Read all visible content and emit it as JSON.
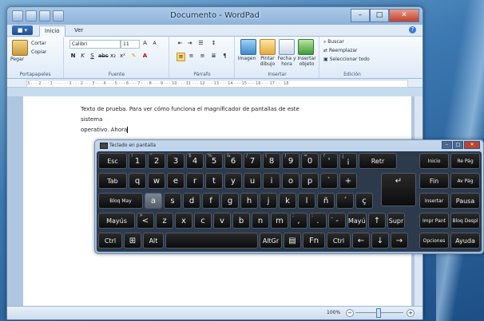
{
  "window": {
    "title": "Documento - WordPad",
    "buttons": {
      "minimize": "–",
      "maximize": "□",
      "close": "✕"
    }
  },
  "ribbon": {
    "file_tab": "■ ▾",
    "tabs": [
      "Inicio",
      "Ver"
    ],
    "clipboard": {
      "paste": "Pegar",
      "cut": "Cortar",
      "copy": "Copiar",
      "label": "Portapapeles"
    },
    "font": {
      "family": "Calibri",
      "size": "11",
      "label": "Fuente"
    },
    "paragraph": {
      "label": "Párrafo"
    },
    "insert": {
      "image": "Imagen",
      "paint": "Pintar dibujo",
      "datetime": "Fecha y hora",
      "object": "Insertar objeto",
      "label": "Insertar"
    },
    "edit": {
      "find": "Buscar",
      "replace": "Reemplazar",
      "select_all": "Seleccionar todo",
      "label": "Edición"
    }
  },
  "ruler": "3 · · · 2 · · · 1 · · · · · · 1 · · · 2 · · · 3 · · · 4 · · · 5 · · · 6 · · · 7 · · · 8 · · · 9 · · · 10 · · · 11 · · · 12 · · · 13 · · · 14 · · · 15 · · · 16 · · · 17 · · · 18",
  "document": {
    "line1": "Texto de prueba. Para ver cómo funciona el magnificador de pantallas de este sistema",
    "line2": "operativo. Ahora"
  },
  "status": {
    "zoom": "100%"
  },
  "osk": {
    "title": "Teclado en pantalla",
    "row1": [
      {
        "id": "esc",
        "label": "Esc"
      },
      {
        "id": "1",
        "label": "1",
        "sub": "!"
      },
      {
        "id": "2",
        "label": "2",
        "sub": "\""
      },
      {
        "id": "3",
        "label": "3",
        "sub": "·"
      },
      {
        "id": "4",
        "label": "4",
        "sub": "$"
      },
      {
        "id": "5",
        "label": "5",
        "sub": "%"
      },
      {
        "id": "6",
        "label": "6",
        "sub": "&"
      },
      {
        "id": "7",
        "label": "7",
        "sub": "/"
      },
      {
        "id": "8",
        "label": "8",
        "sub": "("
      },
      {
        "id": "9",
        "label": "9",
        "sub": ")"
      },
      {
        "id": "0",
        "label": "0",
        "sub": "="
      },
      {
        "id": "apos",
        "label": "'",
        "sub": "?"
      },
      {
        "id": "iexcl",
        "label": "¡",
        "sub": "¿"
      },
      {
        "id": "back",
        "label": "Retr"
      }
    ],
    "row2": [
      {
        "id": "tab",
        "label": "Tab"
      },
      {
        "id": "q",
        "label": "q"
      },
      {
        "id": "w",
        "label": "w"
      },
      {
        "id": "e",
        "label": "e"
      },
      {
        "id": "r",
        "label": "r"
      },
      {
        "id": "t",
        "label": "t"
      },
      {
        "id": "y",
        "label": "y"
      },
      {
        "id": "u",
        "label": "u"
      },
      {
        "id": "i",
        "label": "i"
      },
      {
        "id": "o",
        "label": "o"
      },
      {
        "id": "p",
        "label": "p"
      },
      {
        "id": "grave",
        "label": "`"
      },
      {
        "id": "plus",
        "label": "+"
      }
    ],
    "row3": [
      {
        "id": "caps",
        "label": "Bloq May"
      },
      {
        "id": "a",
        "label": "a"
      },
      {
        "id": "s",
        "label": "s"
      },
      {
        "id": "d",
        "label": "d"
      },
      {
        "id": "f",
        "label": "f"
      },
      {
        "id": "g",
        "label": "g"
      },
      {
        "id": "h",
        "label": "h"
      },
      {
        "id": "j",
        "label": "j"
      },
      {
        "id": "k",
        "label": "k"
      },
      {
        "id": "l",
        "label": "l"
      },
      {
        "id": "ntilde",
        "label": "ñ"
      },
      {
        "id": "acute",
        "label": "´"
      },
      {
        "id": "ccedil",
        "label": "ç"
      }
    ],
    "row4": [
      {
        "id": "lshift",
        "label": "Mayús"
      },
      {
        "id": "lt",
        "label": "<",
        "sub": ">"
      },
      {
        "id": "z",
        "label": "z"
      },
      {
        "id": "x",
        "label": "x"
      },
      {
        "id": "c",
        "label": "c"
      },
      {
        "id": "v",
        "label": "v"
      },
      {
        "id": "b",
        "label": "b"
      },
      {
        "id": "n",
        "label": "n"
      },
      {
        "id": "m",
        "label": "m"
      },
      {
        "id": "comma",
        "label": ",",
        "sub": ";"
      },
      {
        "id": "period",
        "label": ".",
        "sub": ":"
      },
      {
        "id": "minus",
        "label": "-",
        "sub": "_"
      },
      {
        "id": "rshift",
        "label": "Mayús"
      },
      {
        "id": "up",
        "label": "↑"
      },
      {
        "id": "supr",
        "label": "Supr"
      }
    ],
    "row5": [
      {
        "id": "ctrl_l",
        "label": "Ctrl"
      },
      {
        "id": "win",
        "label": "⊞"
      },
      {
        "id": "alt",
        "label": "Alt"
      },
      {
        "id": "space",
        "label": ""
      },
      {
        "id": "altgr",
        "label": "AltGr"
      },
      {
        "id": "menu",
        "label": "▤"
      },
      {
        "id": "fn",
        "label": "Fn"
      },
      {
        "id": "ctrl_r",
        "label": "Ctrl"
      },
      {
        "id": "left",
        "label": "←"
      },
      {
        "id": "down",
        "label": "↓"
      },
      {
        "id": "right",
        "label": "→"
      }
    ],
    "side": [
      {
        "id": "inicio",
        "label": "Inicio"
      },
      {
        "id": "repag",
        "label": "Re Pág"
      },
      {
        "id": "fin",
        "label": "Fin"
      },
      {
        "id": "avpag",
        "label": "Av Pág"
      },
      {
        "id": "insertar",
        "label": "Insertar"
      },
      {
        "id": "pausa",
        "label": "Pausa"
      },
      {
        "id": "imprpant",
        "label": "Impr Pant"
      },
      {
        "id": "bloqdespl",
        "label": "Bloq Despl"
      },
      {
        "id": "opciones",
        "label": "Opciones"
      },
      {
        "id": "ayuda",
        "label": "Ayuda"
      }
    ],
    "pressed_key": "a"
  }
}
